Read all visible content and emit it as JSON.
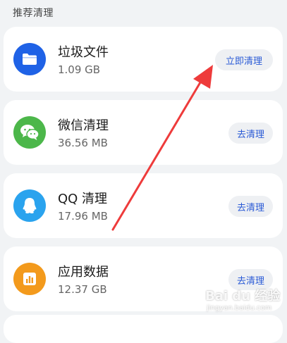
{
  "section": {
    "title": "推荐清理"
  },
  "items": [
    {
      "name": "垃圾文件",
      "size": "1.09 GB",
      "button": "立即清理",
      "icon": "folder-icon",
      "icon_color": "#1f62e6"
    },
    {
      "name": "微信清理",
      "size": "36.56 MB",
      "button": "去清理",
      "icon": "wechat-icon",
      "icon_color": "#4cb74a"
    },
    {
      "name": "QQ 清理",
      "size": "17.96 MB",
      "button": "去清理",
      "icon": "qq-penguin-icon",
      "icon_color": "#2aa3ee"
    },
    {
      "name": "应用数据",
      "size": "12.37 GB",
      "button": "去清理",
      "icon": "chart-icon",
      "icon_color": "#f39a1c"
    }
  ],
  "colors": {
    "background": "#f1f3f5",
    "card": "#ffffff",
    "button_bg": "#eef0f3",
    "button_text": "#2a5ad6",
    "arrow": "#ee3b3b"
  },
  "watermark": {
    "main": "Bai du 经验",
    "sub": "jingyan.baidu.com"
  }
}
